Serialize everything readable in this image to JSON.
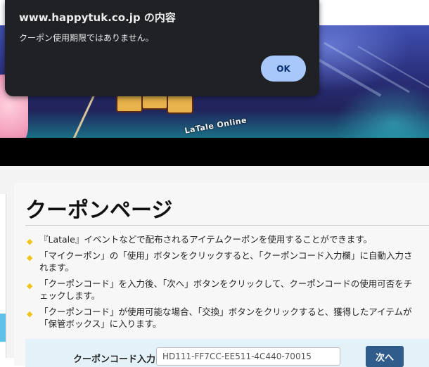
{
  "dialog": {
    "title": "www.happytuk.co.jp の内容",
    "message": "クーポン使用期限ではありません。",
    "ok_label": "OK"
  },
  "banner": {
    "logo_text": "LaTale Online"
  },
  "page": {
    "title": "クーポンページ",
    "bullets": [
      {
        "line1": "『Latale』イベントなどで配布されるアイテムクーポンを使用することができます。",
        "line2": ""
      },
      {
        "line1": "「マイクーポン」の「使用」ボタンをクリックすると、「クーポンコード入力欄」に自動入力さ",
        "line2": "れます。"
      },
      {
        "line1": "「クーポンコード」を入力後、「次へ」ボタンをクリックして、クーポンコードの使用可否をチ",
        "line2": "ェックします。"
      },
      {
        "line1": "「クーポンコード」が使用可能な場合、「交換」ボタンをクリックすると、獲得したアイテムが",
        "line2": "「保管ボックス」に入ります。"
      }
    ],
    "form": {
      "label": "クーポンコード入力",
      "code_value": "HD111-FF7CC-EE511-4C440-70015",
      "next_label": "次へ"
    }
  },
  "colors": {
    "dialog_bg": "#202124",
    "ok_button": "#a8c7fa",
    "bullet": "#f0c419",
    "form_bg": "#e3f1f8",
    "next_button": "#2f5c8a"
  }
}
